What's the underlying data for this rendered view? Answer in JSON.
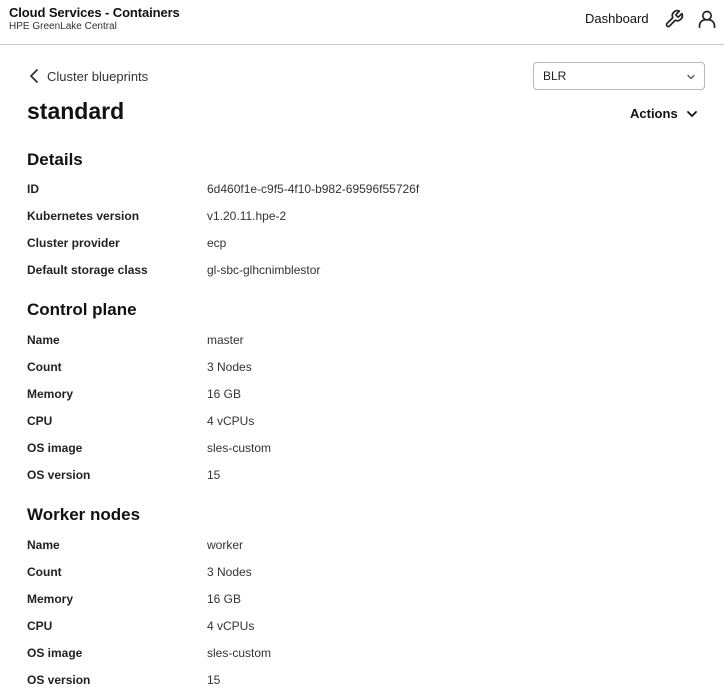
{
  "header": {
    "title": "Cloud Services - Containers",
    "subtitle": "HPE GreenLake Central",
    "dashboard_label": "Dashboard",
    "icons": [
      "wrench-icon",
      "user-icon"
    ]
  },
  "nav": {
    "back_label": "Cluster blueprints",
    "region_value": "BLR"
  },
  "page": {
    "title": "standard",
    "actions_label": "Actions"
  },
  "sections": [
    {
      "heading": "Details",
      "rows": [
        {
          "label": "ID",
          "value": "6d460f1e-c9f5-4f10-b982-69596f55726f"
        },
        {
          "label": "Kubernetes version",
          "value": "v1.20.11.hpe-2"
        },
        {
          "label": "Cluster provider",
          "value": "ecp"
        },
        {
          "label": "Default storage class",
          "value": "gl-sbc-glhcnimblestor"
        }
      ]
    },
    {
      "heading": "Control plane",
      "rows": [
        {
          "label": "Name",
          "value": "master"
        },
        {
          "label": "Count",
          "value": "3 Nodes"
        },
        {
          "label": "Memory",
          "value": "16 GB"
        },
        {
          "label": "CPU",
          "value": "4 vCPUs"
        },
        {
          "label": "OS image",
          "value": "sles-custom"
        },
        {
          "label": "OS version",
          "value": "15"
        }
      ]
    },
    {
      "heading": "Worker nodes",
      "rows": [
        {
          "label": "Name",
          "value": "worker"
        },
        {
          "label": "Count",
          "value": "3 Nodes"
        },
        {
          "label": "Memory",
          "value": "16 GB"
        },
        {
          "label": "CPU",
          "value": "4 vCPUs"
        },
        {
          "label": "OS image",
          "value": "sles-custom"
        },
        {
          "label": "OS version",
          "value": "15"
        }
      ]
    }
  ]
}
